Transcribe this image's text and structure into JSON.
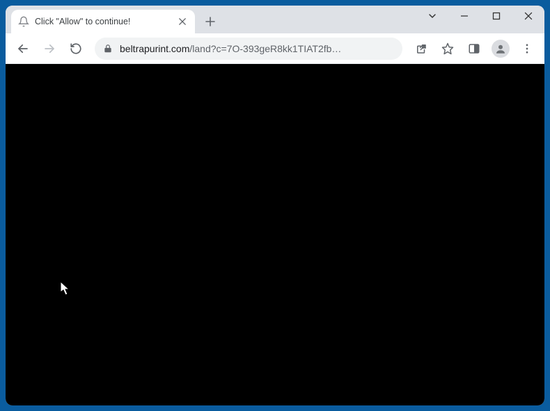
{
  "tab": {
    "title": "Click \"Allow\" to continue!"
  },
  "omnibox": {
    "domain": "beltrapurint.com",
    "path": "/land?c=7O-393geR8kk1TIAT2fb…"
  },
  "colors": {
    "windowFrame": "#0a5c9e",
    "tabstrip": "#dee1e6",
    "toolbar": "#ffffff",
    "omnibox": "#f1f3f4",
    "content": "#000000"
  }
}
